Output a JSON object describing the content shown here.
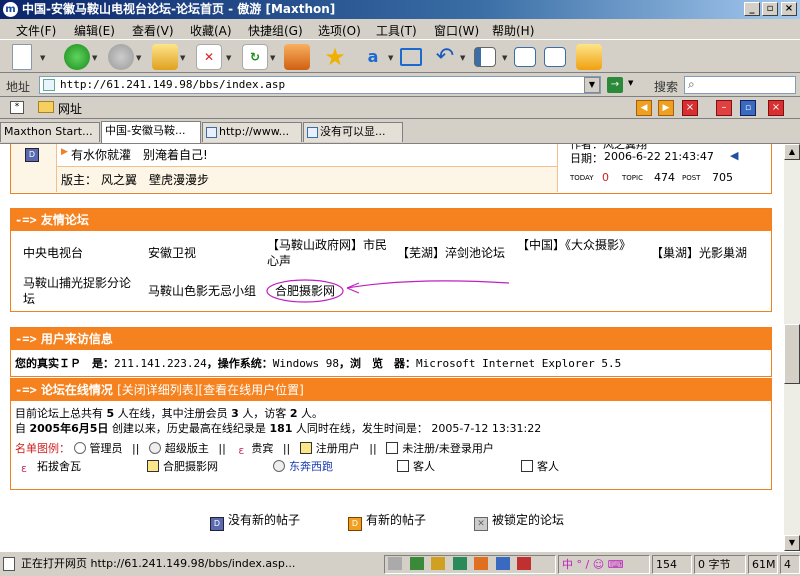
{
  "window": {
    "title": "中国-安徽马鞍山电视台论坛-论坛首页 - 傲游 [Maxthon]"
  },
  "menu": [
    "文件(F)",
    "编辑(E)",
    "查看(V)",
    "收藏(A)",
    "快捷组(G)",
    "选项(O)",
    "工具(T)",
    "窗口(W)",
    "帮助(H)"
  ],
  "address": {
    "label": "地址",
    "url": "http://61.241.149.98/bbs/index.asp",
    "search_label": "搜索"
  },
  "favbar": {
    "label": "网址"
  },
  "tabs": [
    "Maxthon Start...",
    "中国-安徽马鞍...",
    "http://www...",
    "没有可以显..."
  ],
  "top_post": {
    "title": "有水你就灌　别淹着自己!",
    "moderator_label": "版主：",
    "moderators": "风之翼　壁虎漫漫步",
    "author_partial": "作者：风之翼翔",
    "date_label": "日期：",
    "date": "2006-6-22 21:43:47",
    "today_label": "TODAY",
    "today": "0",
    "topic_label": "TOPIC",
    "topic": "474",
    "post_label": "POST",
    "post": "705"
  },
  "friends": {
    "arrow": "-=>",
    "title": "友情论坛",
    "links": [
      "中央电视台",
      "安徽卫视",
      "【马鞍山政府网】市民心声",
      "【芜湖】淬剑池论坛",
      "【中国】《大众摄影》",
      "【巢湖】光影巢湖",
      "马鞍山捕光捉影分论坛",
      "马鞍山色影无忌小组",
      "合肥摄影网"
    ]
  },
  "visitor": {
    "arrow": "-=>",
    "title": "用户来访信息",
    "ip_label": "您的真实ＩＰ　是：",
    "ip": "211.141.223.24",
    "os_label": "，操作系统：",
    "os": "Windows 98",
    "browser_label": "，浏　览　器：",
    "browser": "Microsoft Internet Explorer 5.5"
  },
  "online": {
    "arrow": "-=>",
    "title": "论坛在线情况",
    "links": "[关闭详细列表][查看在线用户位置]",
    "line1_a": "目前论坛上总共有",
    "total": "5",
    "line1_b": "人在线，其中注册会员",
    "members": "3",
    "line1_c": "人，访客",
    "guests": "2",
    "line1_d": "人。",
    "line2_a": "自",
    "since": "2005年6月5日",
    "line2_b": "创建以来，历史最高在线纪录是",
    "record": "181",
    "line2_c": "人同时在线，发生时间是：",
    "record_time": "2005-7-12 13:31:22",
    "legend_label": "名单图例：",
    "legend": [
      "管理员",
      "超级版主",
      "贵宾",
      "注册用户",
      "未注册/未登录用户"
    ],
    "sep": "||",
    "users": [
      "拓拔舍瓦",
      "合肥摄影网",
      "东奔西跑",
      "客人",
      "客人"
    ]
  },
  "footer_legend": [
    "没有新的帖子",
    "有新的帖子",
    "被锁定的论坛"
  ],
  "status": {
    "text": "正在打开网页 http://61.241.149.98/bbs/index.asp...",
    "count": "154",
    "bytes": "0 字节",
    "mem": "61M",
    "num": "4",
    "ime": "中 ° / ☺ ⌨"
  },
  "colors": {
    "orange": "#f5821f",
    "titlebar": "#0a246a"
  }
}
